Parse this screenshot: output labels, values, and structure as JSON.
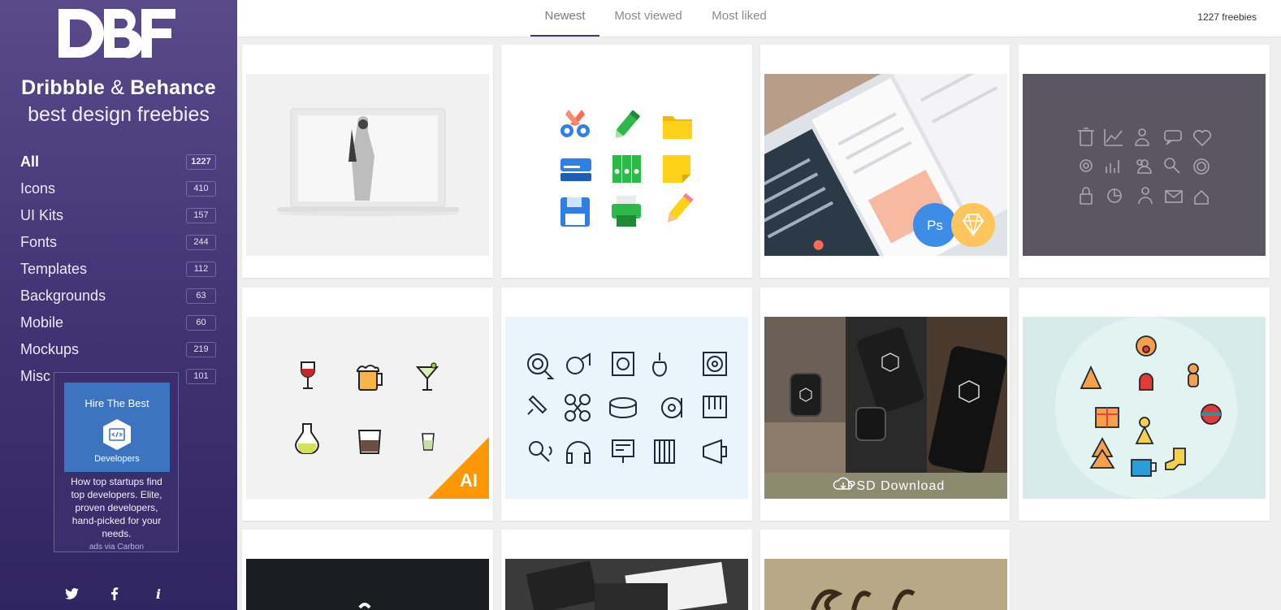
{
  "brand": {
    "logo_text": "DBF",
    "line1_a": "Dribbble",
    "line1_amp": "&",
    "line1_b": "Behance",
    "line2": "best design freebies"
  },
  "nav": [
    {
      "label": "All",
      "count": "1227"
    },
    {
      "label": "Icons",
      "count": "410"
    },
    {
      "label": "UI Kits",
      "count": "157"
    },
    {
      "label": "Fonts",
      "count": "244"
    },
    {
      "label": "Templates",
      "count": "112"
    },
    {
      "label": "Backgrounds",
      "count": "63"
    },
    {
      "label": "Mobile",
      "count": "60"
    },
    {
      "label": "Mockups",
      "count": "219"
    },
    {
      "label": "Misc",
      "count": "101"
    }
  ],
  "ad": {
    "title": "Hire The Best",
    "subtitle": "Developers",
    "text": "How top startups find top developers. Elite, proven developers, hand-picked for your needs.",
    "via": "ads via Carbon"
  },
  "socials": [
    "twitter-icon",
    "facebook-icon",
    "info-icon"
  ],
  "tabs": [
    "Newest",
    "Most viewed",
    "Most liked"
  ],
  "total": "1227 freebies",
  "card_badges": {
    "ps": "Ps",
    "ai": "AI",
    "psd_download": "PSD Download"
  },
  "colors": {
    "sidebar_top": "#5a4a8c",
    "sidebar_bottom": "#2f2560",
    "active_tab": "#3f3475"
  }
}
